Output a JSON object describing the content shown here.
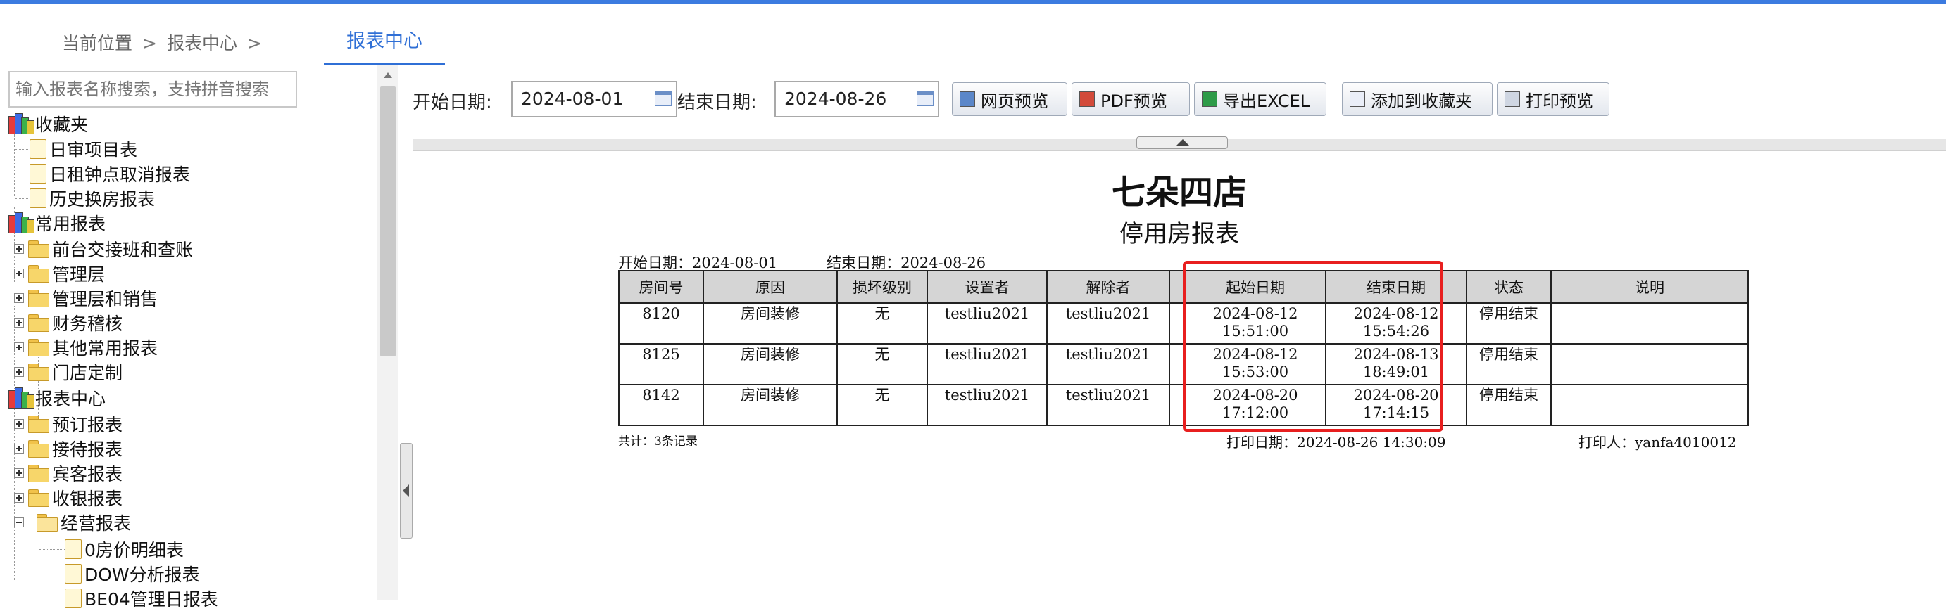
{
  "header": {
    "breadcrumb": [
      "当前位置",
      "报表中心"
    ],
    "breadcrumb_sep": ">",
    "active_tab": "报表中心"
  },
  "sidebar": {
    "search_placeholder": "输入报表名称搜索，支持拼音搜索",
    "tree": {
      "favorites": "收藏夹",
      "fav_items": [
        "日审项目表",
        "日租钟点取消报表",
        "历史换房报表"
      ],
      "common": "常用报表",
      "common_items": [
        "前台交接班和查账",
        "管理层",
        "管理层和销售",
        "财务稽核",
        "其他常用报表",
        "门店定制"
      ],
      "center": "报表中心",
      "center_items": [
        "预订报表",
        "接待报表",
        "宾客报表",
        "收银报表",
        "经营报表"
      ],
      "business_items": [
        "0房价明细表",
        "DOW分析报表",
        "BE04管理日报表"
      ]
    }
  },
  "toolbar": {
    "start_label": "开始日期:",
    "start_value": "2024-08-01",
    "end_label": "结束日期:",
    "end_value": "2024-08-26",
    "buttons": [
      "网页预览",
      "PDF预览",
      "导出EXCEL",
      "添加到收藏夹",
      "打印预览"
    ]
  },
  "report": {
    "title": "七朵四店",
    "subtitle": "停用房报表",
    "range_start": "开始日期：2024-08-01",
    "range_end": "结束日期：2024-08-26",
    "columns": [
      "房间号",
      "原因",
      "损坏级别",
      "设置者",
      "解除者",
      "",
      "起始日期",
      "结束日期",
      "状态",
      "说明"
    ],
    "rows": [
      {
        "room": "8120",
        "reason": "房间装修",
        "level": "无",
        "setter": "testliu2021",
        "releaser": "testliu2021",
        "blank": "",
        "start_date": "2024-08-12",
        "start_time": "15:51:00",
        "end_date": "2024-08-12",
        "end_time": "15:54:26",
        "status": "停用结束",
        "note": ""
      },
      {
        "room": "8125",
        "reason": "房间装修",
        "level": "无",
        "setter": "testliu2021",
        "releaser": "testliu2021",
        "blank": "",
        "start_date": "2024-08-12",
        "start_time": "15:53:00",
        "end_date": "2024-08-13",
        "end_time": "18:49:01",
        "status": "停用结束",
        "note": ""
      },
      {
        "room": "8142",
        "reason": "房间装修",
        "level": "无",
        "setter": "testliu2021",
        "releaser": "testliu2021",
        "blank": "",
        "start_date": "2024-08-20",
        "start_time": "17:12:00",
        "end_date": "2024-08-20",
        "end_time": "17:14:15",
        "status": "停用结束",
        "note": ""
      }
    ],
    "footer_total": "共计：3条记录",
    "footer_print_date": "打印日期：2024-08-26 14:30:09",
    "footer_printer": "打印人：yanfa4010012"
  },
  "colors": {
    "accent": "#2f6fd6",
    "topbar": "#3c7be0",
    "highlight": "#e81f1f"
  }
}
